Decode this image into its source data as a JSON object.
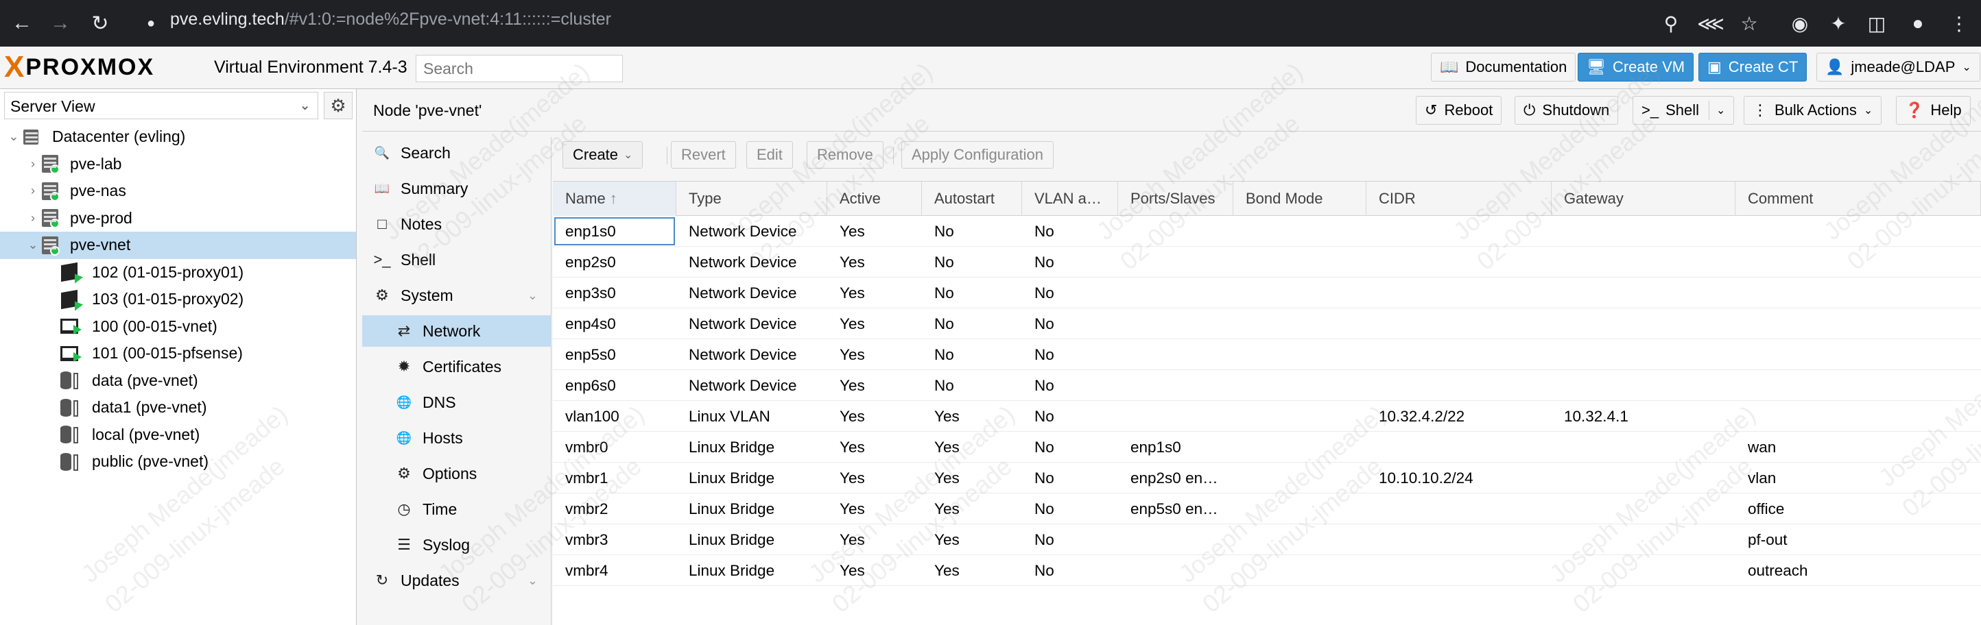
{
  "browser": {
    "url_host": "pve.evling.tech",
    "url_rest": "/#v1:0:=node%2Fpve-vnet:4:11::::::=cluster"
  },
  "header": {
    "logo_word": "PROXMOX",
    "version": "Virtual Environment 7.4-3",
    "search_placeholder": "Search",
    "documentation": "Documentation",
    "create_vm": "Create VM",
    "create_ct": "Create CT",
    "user": "jmeade@LDAP"
  },
  "left": {
    "view": "Server View",
    "tree": [
      {
        "label": "Datacenter (evling)",
        "type": "datacenter",
        "level": 0,
        "expanded": true
      },
      {
        "label": "pve-lab",
        "type": "node",
        "level": 1,
        "expanded": false
      },
      {
        "label": "pve-nas",
        "type": "node",
        "level": 1,
        "expanded": false
      },
      {
        "label": "pve-prod",
        "type": "node",
        "level": 1,
        "expanded": false
      },
      {
        "label": "pve-vnet",
        "type": "node",
        "level": 1,
        "expanded": true,
        "selected": true
      },
      {
        "label": "102 (01-015-proxy01)",
        "type": "ct",
        "level": 2
      },
      {
        "label": "103 (01-015-proxy02)",
        "type": "ct",
        "level": 2
      },
      {
        "label": "100 (00-015-vnet)",
        "type": "vm",
        "level": 2
      },
      {
        "label": "101 (00-015-pfsense)",
        "type": "vm",
        "level": 2
      },
      {
        "label": "data (pve-vnet)",
        "type": "storage",
        "level": 2
      },
      {
        "label": "data1 (pve-vnet)",
        "type": "storage",
        "level": 2
      },
      {
        "label": "local (pve-vnet)",
        "type": "storage",
        "level": 2
      },
      {
        "label": "public (pve-vnet)",
        "type": "storage",
        "level": 2
      }
    ]
  },
  "content": {
    "title": "Node 'pve-vnet'",
    "reboot": "Reboot",
    "shutdown": "Shutdown",
    "shell": "Shell",
    "bulk_actions": "Bulk Actions",
    "help": "Help"
  },
  "nav": [
    {
      "label": "Search",
      "icon": "search-icon",
      "sub": false
    },
    {
      "label": "Summary",
      "icon": "book-icon",
      "sub": false
    },
    {
      "label": "Notes",
      "icon": "notes-icon",
      "sub": false
    },
    {
      "label": "Shell",
      "icon": "terminal-icon",
      "sub": false
    },
    {
      "label": "System",
      "icon": "cogs-icon",
      "sub": false,
      "collapsible": true
    },
    {
      "label": "Network",
      "icon": "exchange-icon",
      "sub": true,
      "active": true
    },
    {
      "label": "Certificates",
      "icon": "certificate-icon",
      "sub": true
    },
    {
      "label": "DNS",
      "icon": "globe-icon",
      "sub": true
    },
    {
      "label": "Hosts",
      "icon": "globe-icon",
      "sub": true
    },
    {
      "label": "Options",
      "icon": "gear-icon",
      "sub": true
    },
    {
      "label": "Time",
      "icon": "clock-icon",
      "sub": true
    },
    {
      "label": "Syslog",
      "icon": "list-icon",
      "sub": true
    },
    {
      "label": "Updates",
      "icon": "refresh-icon",
      "sub": false,
      "collapsible": true
    }
  ],
  "toolbar": {
    "create": "Create",
    "revert": "Revert",
    "edit": "Edit",
    "remove": "Remove",
    "apply": "Apply Configuration"
  },
  "grid": {
    "columns": [
      "Name",
      "Type",
      "Active",
      "Autostart",
      "VLAN a…",
      "Ports/Slaves",
      "Bond Mode",
      "CIDR",
      "Gateway",
      "Comment"
    ],
    "rows": [
      [
        "enp1s0",
        "Network Device",
        "Yes",
        "No",
        "No",
        "",
        "",
        "",
        "",
        ""
      ],
      [
        "enp2s0",
        "Network Device",
        "Yes",
        "No",
        "No",
        "",
        "",
        "",
        "",
        ""
      ],
      [
        "enp3s0",
        "Network Device",
        "Yes",
        "No",
        "No",
        "",
        "",
        "",
        "",
        ""
      ],
      [
        "enp4s0",
        "Network Device",
        "Yes",
        "No",
        "No",
        "",
        "",
        "",
        "",
        ""
      ],
      [
        "enp5s0",
        "Network Device",
        "Yes",
        "No",
        "No",
        "",
        "",
        "",
        "",
        ""
      ],
      [
        "enp6s0",
        "Network Device",
        "Yes",
        "No",
        "No",
        "",
        "",
        "",
        "",
        ""
      ],
      [
        "vlan100",
        "Linux VLAN",
        "Yes",
        "Yes",
        "No",
        "",
        "",
        "10.32.4.2/22",
        "10.32.4.1",
        ""
      ],
      [
        "vmbr0",
        "Linux Bridge",
        "Yes",
        "Yes",
        "No",
        "enp1s0",
        "",
        "",
        "",
        "wan"
      ],
      [
        "vmbr1",
        "Linux Bridge",
        "Yes",
        "Yes",
        "No",
        "enp2s0 en…",
        "",
        "10.10.10.2/24",
        "",
        "vlan"
      ],
      [
        "vmbr2",
        "Linux Bridge",
        "Yes",
        "Yes",
        "No",
        "enp5s0 en…",
        "",
        "",
        "",
        "office"
      ],
      [
        "vmbr3",
        "Linux Bridge",
        "Yes",
        "Yes",
        "No",
        "",
        "",
        "",
        "",
        "pf-out"
      ],
      [
        "vmbr4",
        "Linux Bridge",
        "Yes",
        "Yes",
        "No",
        "",
        "",
        "",
        "",
        "outreach"
      ]
    ]
  },
  "watermark": [
    "Joseph Meade(jmeade)",
    "02-009-linux-jmeade"
  ],
  "colors": {
    "accent": "#3892d4",
    "logo": "#e57000",
    "selected": "#c2ddf2",
    "status_ok": "#21bf4b"
  }
}
